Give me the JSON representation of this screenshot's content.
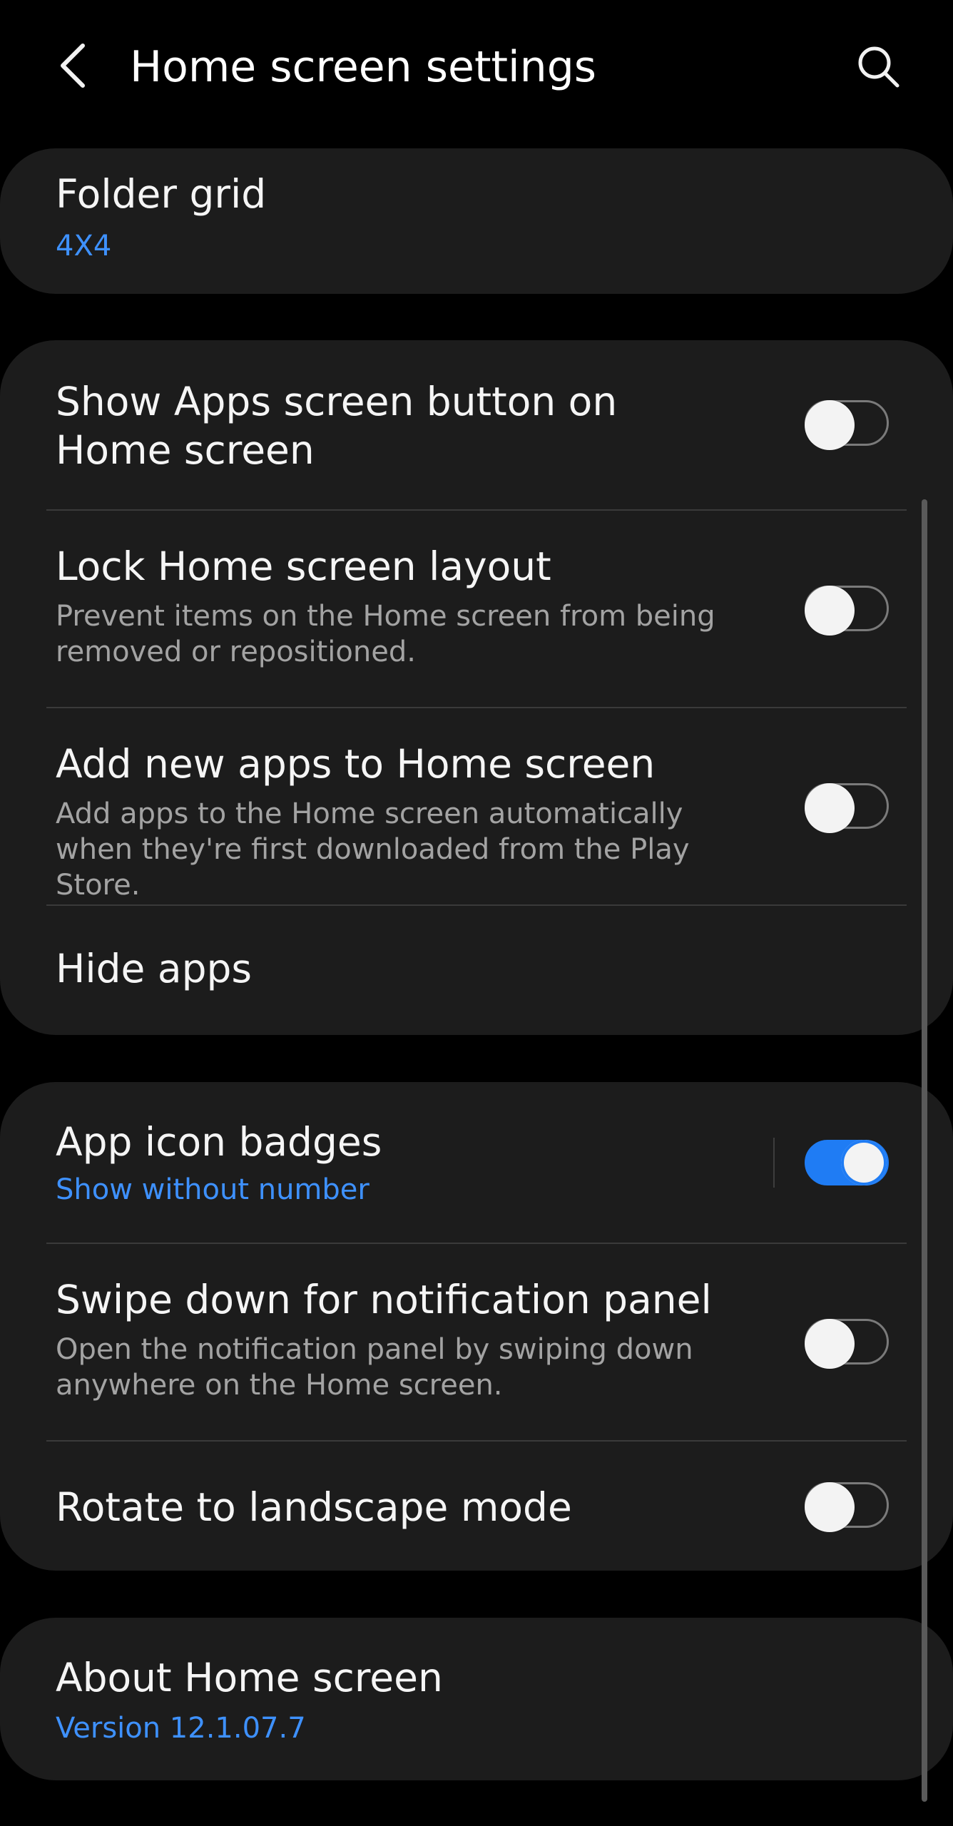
{
  "header": {
    "title": "Home screen settings",
    "back_icon": "chevron-left-icon",
    "search_icon": "search-icon"
  },
  "folder_grid": {
    "title": "Folder grid",
    "value": "4X4"
  },
  "layout_group": {
    "show_apps_button": {
      "title": "Show Apps screen button on Home screen",
      "enabled": false
    },
    "lock_layout": {
      "title": "Lock Home screen layout",
      "description": "Prevent items on the Home screen from being removed or repositioned.",
      "enabled": false
    },
    "add_new_apps": {
      "title": "Add new apps to Home screen",
      "description": "Add apps to the Home screen automatically when they're first downloaded from the Play Store.",
      "enabled": false
    },
    "hide_apps": {
      "title": "Hide apps"
    }
  },
  "behavior_group": {
    "app_icon_badges": {
      "title": "App icon badges",
      "value": "Show without number",
      "enabled": true
    },
    "swipe_down": {
      "title": "Swipe down for notification panel",
      "description": "Open the notification panel by swiping down anywhere on the Home screen.",
      "enabled": false
    },
    "rotate_landscape": {
      "title": "Rotate to landscape mode",
      "enabled": false
    }
  },
  "about": {
    "title": "About Home screen",
    "version": "Version 12.1.07.7"
  },
  "colors": {
    "background": "#000000",
    "card": "#1c1c1c",
    "accent": "#3e91ff",
    "toggle_on": "#1f7cf4",
    "secondary_text": "#a3a3a3"
  }
}
